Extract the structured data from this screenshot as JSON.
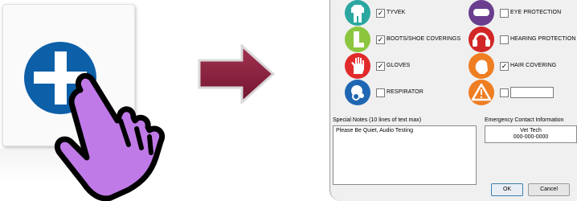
{
  "illustration": {
    "tile_icon": "plus-circle-icon",
    "pointer_icon": "hand-pointer-icon",
    "arrow_icon": "right-arrow-icon",
    "colors": {
      "plus_blue": "#0d5fa8",
      "hand_purple": "#c07ae8",
      "arrow_maroon": "#8a1f3a"
    }
  },
  "dialog": {
    "ppe_items": [
      {
        "label": "TYVEK",
        "checked": "✓",
        "icon": "coverall-icon",
        "color": "#2aa7a0"
      },
      {
        "label": "BOOTS/SHOE COVERINGS",
        "checked": "✓",
        "icon": "boot-icon",
        "color": "#8cc63f"
      },
      {
        "label": "GLOVES",
        "checked": "✓",
        "icon": "glove-icon",
        "color": "#e12b2b"
      },
      {
        "label": "RESPIRATOR",
        "checked": "",
        "icon": "respirator-icon",
        "color": "#1f67b3"
      },
      {
        "label": "EYE PROTECTION",
        "checked": "",
        "icon": "goggles-icon",
        "color": "#6a3d8f"
      },
      {
        "label": "HEARING PROTECTION",
        "checked": "",
        "icon": "earmuffs-icon",
        "color": "#d22626"
      },
      {
        "label": "HAIR COVERING",
        "checked": "✓",
        "icon": "hair-cover-icon",
        "color": "#ef7d22"
      },
      {
        "label": "",
        "checked": "",
        "icon": "warning-icon",
        "color": "#ef7d22"
      }
    ],
    "other_field_value": "",
    "notes_label": "Special Notes (10 lines of text max)",
    "notes_text": "Please Be Quiet, Audio Testing",
    "contact_label": "Emergency Contact Information",
    "contact_name": "Vet Tech",
    "contact_phone": "000-000-0000",
    "ok_label": "OK",
    "cancel_label": "Cancel"
  }
}
